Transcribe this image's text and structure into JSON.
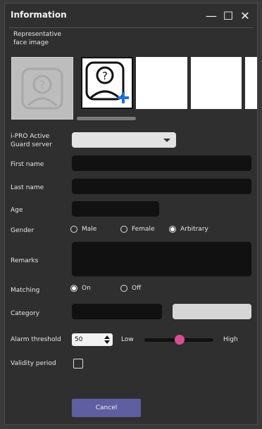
{
  "window": {
    "title": "Information",
    "controls": {
      "minimize": "—",
      "maximize": "☐",
      "close": "✕"
    }
  },
  "face": {
    "representative_label": "Representative face image",
    "thumbnails_count_visible": 4
  },
  "form": {
    "server_label": "i-PRO Active Guard server",
    "server_value": "",
    "first_name_label": "First name",
    "first_name_value": "",
    "last_name_label": "Last name",
    "last_name_value": "",
    "age_label": "Age",
    "age_value": "",
    "gender_label": "Gender",
    "gender_options": [
      "Male",
      "Female",
      "Arbitrary"
    ],
    "gender_selected": "Arbitrary",
    "remarks_label": "Remarks",
    "remarks_value": "",
    "matching_label": "Matching",
    "matching_options": [
      "On",
      "Off"
    ],
    "matching_selected": "On",
    "category_label": "Category",
    "category_value": "",
    "alarm_threshold_label": "Alarm threshold",
    "alarm_threshold_value": "50",
    "alarm_low_label": "Low",
    "alarm_high_label": "High",
    "alarm_slider_position": 0.5,
    "validity_label": "Validity period",
    "validity_checked": false
  },
  "buttons": {
    "cancel_label": "Cancel"
  },
  "colors": {
    "accent_purple": "#5e5ea0",
    "slider_thumb": "#d94f93",
    "add_plus": "#1f6fd6"
  },
  "icons": {
    "face_placeholder": "question-face-icon",
    "add_face": "add-face-icon"
  }
}
